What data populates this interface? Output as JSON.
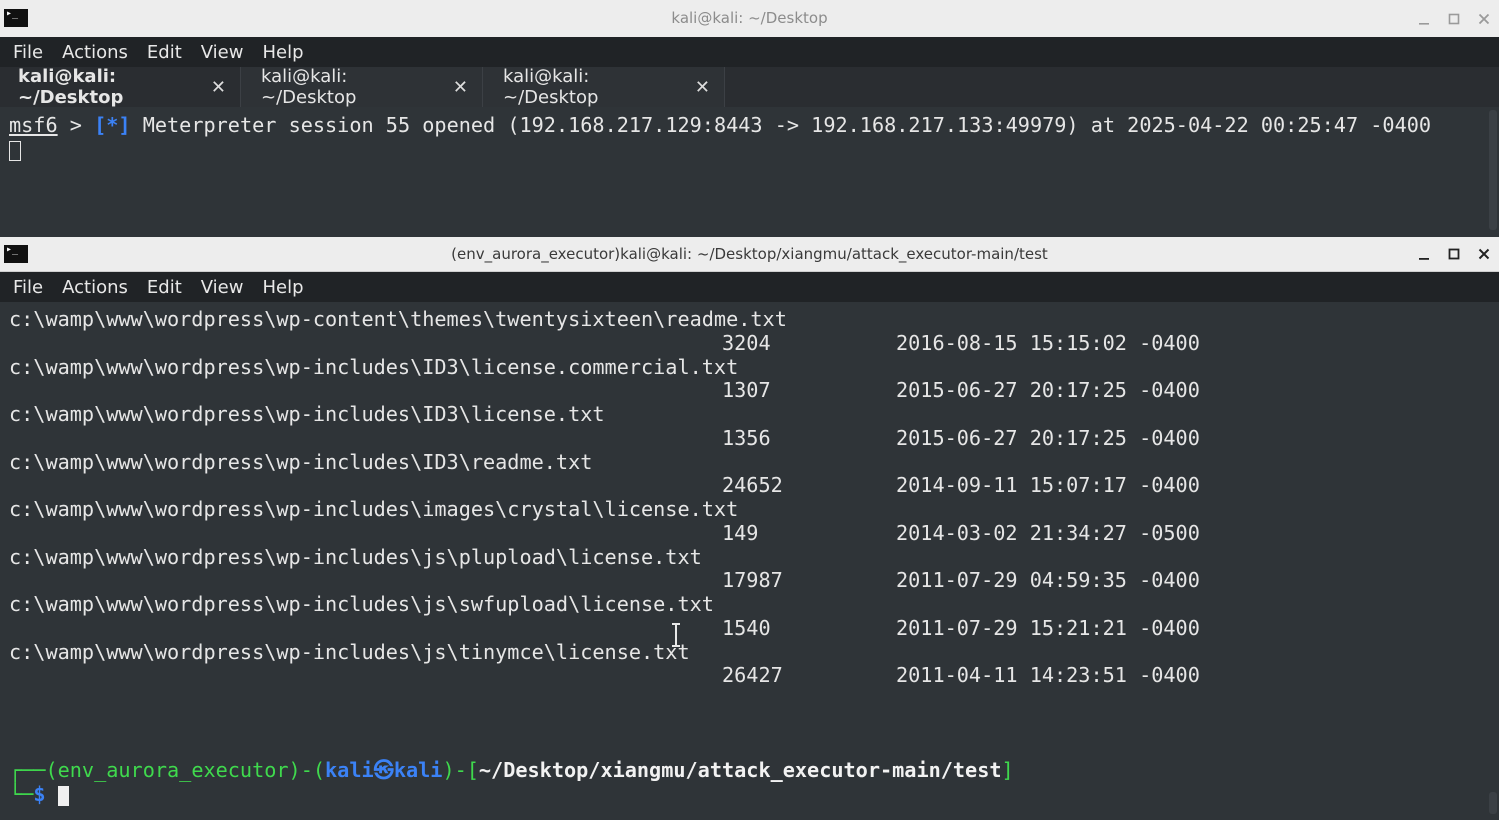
{
  "window1": {
    "title": "kali@kali: ~/Desktop",
    "menu": [
      "File",
      "Actions",
      "Edit",
      "View",
      "Help"
    ],
    "tabs": [
      {
        "label": "kali@kali: ~/Desktop",
        "active": true
      },
      {
        "label": "kali@kali: ~/Desktop",
        "active": false
      },
      {
        "label": "kali@kali: ~/Desktop",
        "active": false
      }
    ],
    "prompt_name": "msf6",
    "prompt_arrow": " > ",
    "status_tag": "[*]",
    "message": " Meterpreter session 55 opened (192.168.217.129:8443 -> 192.168.217.133:49979) at 2025-04-22 00:25:47 -0400"
  },
  "window2": {
    "title": "(env_aurora_executor)kali@kali: ~/Desktop/xiangmu/attack_executor-main/test",
    "menu": [
      "File",
      "Actions",
      "Edit",
      "View",
      "Help"
    ],
    "files": [
      {
        "path": "c:\\wamp\\www\\wordpress\\wp-content\\themes\\twentysixteen\\readme.txt",
        "size": "3204",
        "modified": "2016-08-15 15:15:02 -0400"
      },
      {
        "path": "c:\\wamp\\www\\wordpress\\wp-includes\\ID3\\license.commercial.txt",
        "size": "1307",
        "modified": "2015-06-27 20:17:25 -0400"
      },
      {
        "path": "c:\\wamp\\www\\wordpress\\wp-includes\\ID3\\license.txt",
        "size": "1356",
        "modified": "2015-06-27 20:17:25 -0400"
      },
      {
        "path": "c:\\wamp\\www\\wordpress\\wp-includes\\ID3\\readme.txt",
        "size": "24652",
        "modified": "2014-09-11 15:07:17 -0400"
      },
      {
        "path": "c:\\wamp\\www\\wordpress\\wp-includes\\images\\crystal\\license.txt",
        "size": "149",
        "modified": "2014-03-02 21:34:27 -0500"
      },
      {
        "path": "c:\\wamp\\www\\wordpress\\wp-includes\\js\\plupload\\license.txt",
        "size": "17987",
        "modified": "2011-07-29 04:59:35 -0400"
      },
      {
        "path": "c:\\wamp\\www\\wordpress\\wp-includes\\js\\swfupload\\license.txt",
        "size": "1540",
        "modified": "2011-07-29 15:21:21 -0400"
      },
      {
        "path": "c:\\wamp\\www\\wordpress\\wp-includes\\js\\tinymce\\license.txt",
        "size": "26427",
        "modified": "2011-04-11 14:23:51 -0400"
      }
    ],
    "prompt": {
      "corner_top": "┌──",
      "env": "(env_aurora_executor)",
      "dash": "-",
      "open": "(",
      "user_host": "kali㉿kali",
      "close": ")",
      "dash2": "-",
      "bracket_open": "[",
      "cwd": "~/Desktop/xiangmu/attack_executor-main/test",
      "bracket_close": "]",
      "corner_bottom": "└─",
      "symbol": "$"
    }
  },
  "colors": {
    "terminal_bg": "#2f3438",
    "prompt_green": "#3fd94d",
    "prompt_blue": "#3b82f6",
    "titlebar": "#ededed",
    "menubar": "#202326"
  },
  "icons": [
    "terminal-app-icon",
    "minimize-icon",
    "maximize-icon",
    "close-icon",
    "tab-close-icon",
    "text-cursor-icon"
  ]
}
